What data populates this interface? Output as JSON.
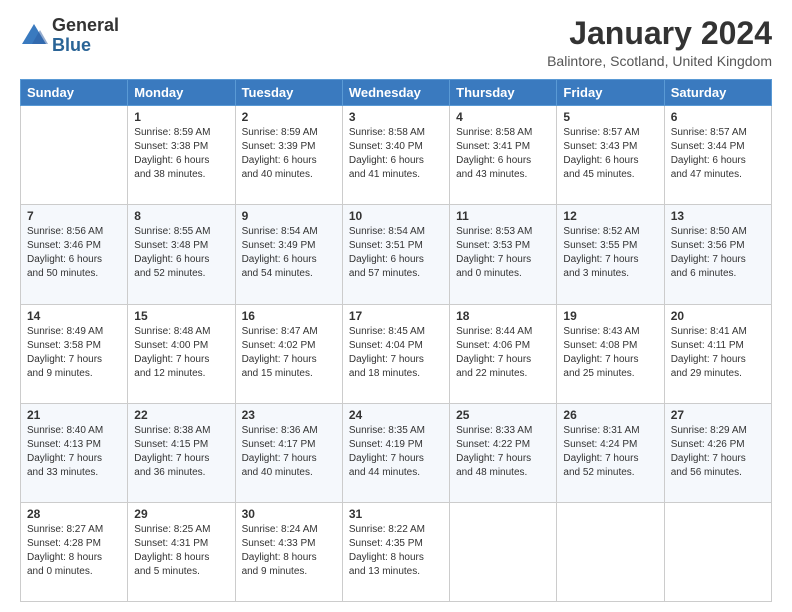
{
  "header": {
    "logo_general": "General",
    "logo_blue": "Blue",
    "title": "January 2024",
    "subtitle": "Balintore, Scotland, United Kingdom"
  },
  "days_of_week": [
    "Sunday",
    "Monday",
    "Tuesday",
    "Wednesday",
    "Thursday",
    "Friday",
    "Saturday"
  ],
  "weeks": [
    [
      {
        "day": "",
        "info": ""
      },
      {
        "day": "1",
        "info": "Sunrise: 8:59 AM\nSunset: 3:38 PM\nDaylight: 6 hours\nand 38 minutes."
      },
      {
        "day": "2",
        "info": "Sunrise: 8:59 AM\nSunset: 3:39 PM\nDaylight: 6 hours\nand 40 minutes."
      },
      {
        "day": "3",
        "info": "Sunrise: 8:58 AM\nSunset: 3:40 PM\nDaylight: 6 hours\nand 41 minutes."
      },
      {
        "day": "4",
        "info": "Sunrise: 8:58 AM\nSunset: 3:41 PM\nDaylight: 6 hours\nand 43 minutes."
      },
      {
        "day": "5",
        "info": "Sunrise: 8:57 AM\nSunset: 3:43 PM\nDaylight: 6 hours\nand 45 minutes."
      },
      {
        "day": "6",
        "info": "Sunrise: 8:57 AM\nSunset: 3:44 PM\nDaylight: 6 hours\nand 47 minutes."
      }
    ],
    [
      {
        "day": "7",
        "info": "Sunrise: 8:56 AM\nSunset: 3:46 PM\nDaylight: 6 hours\nand 50 minutes."
      },
      {
        "day": "8",
        "info": "Sunrise: 8:55 AM\nSunset: 3:48 PM\nDaylight: 6 hours\nand 52 minutes."
      },
      {
        "day": "9",
        "info": "Sunrise: 8:54 AM\nSunset: 3:49 PM\nDaylight: 6 hours\nand 54 minutes."
      },
      {
        "day": "10",
        "info": "Sunrise: 8:54 AM\nSunset: 3:51 PM\nDaylight: 6 hours\nand 57 minutes."
      },
      {
        "day": "11",
        "info": "Sunrise: 8:53 AM\nSunset: 3:53 PM\nDaylight: 7 hours\nand 0 minutes."
      },
      {
        "day": "12",
        "info": "Sunrise: 8:52 AM\nSunset: 3:55 PM\nDaylight: 7 hours\nand 3 minutes."
      },
      {
        "day": "13",
        "info": "Sunrise: 8:50 AM\nSunset: 3:56 PM\nDaylight: 7 hours\nand 6 minutes."
      }
    ],
    [
      {
        "day": "14",
        "info": "Sunrise: 8:49 AM\nSunset: 3:58 PM\nDaylight: 7 hours\nand 9 minutes."
      },
      {
        "day": "15",
        "info": "Sunrise: 8:48 AM\nSunset: 4:00 PM\nDaylight: 7 hours\nand 12 minutes."
      },
      {
        "day": "16",
        "info": "Sunrise: 8:47 AM\nSunset: 4:02 PM\nDaylight: 7 hours\nand 15 minutes."
      },
      {
        "day": "17",
        "info": "Sunrise: 8:45 AM\nSunset: 4:04 PM\nDaylight: 7 hours\nand 18 minutes."
      },
      {
        "day": "18",
        "info": "Sunrise: 8:44 AM\nSunset: 4:06 PM\nDaylight: 7 hours\nand 22 minutes."
      },
      {
        "day": "19",
        "info": "Sunrise: 8:43 AM\nSunset: 4:08 PM\nDaylight: 7 hours\nand 25 minutes."
      },
      {
        "day": "20",
        "info": "Sunrise: 8:41 AM\nSunset: 4:11 PM\nDaylight: 7 hours\nand 29 minutes."
      }
    ],
    [
      {
        "day": "21",
        "info": "Sunrise: 8:40 AM\nSunset: 4:13 PM\nDaylight: 7 hours\nand 33 minutes."
      },
      {
        "day": "22",
        "info": "Sunrise: 8:38 AM\nSunset: 4:15 PM\nDaylight: 7 hours\nand 36 minutes."
      },
      {
        "day": "23",
        "info": "Sunrise: 8:36 AM\nSunset: 4:17 PM\nDaylight: 7 hours\nand 40 minutes."
      },
      {
        "day": "24",
        "info": "Sunrise: 8:35 AM\nSunset: 4:19 PM\nDaylight: 7 hours\nand 44 minutes."
      },
      {
        "day": "25",
        "info": "Sunrise: 8:33 AM\nSunset: 4:22 PM\nDaylight: 7 hours\nand 48 minutes."
      },
      {
        "day": "26",
        "info": "Sunrise: 8:31 AM\nSunset: 4:24 PM\nDaylight: 7 hours\nand 52 minutes."
      },
      {
        "day": "27",
        "info": "Sunrise: 8:29 AM\nSunset: 4:26 PM\nDaylight: 7 hours\nand 56 minutes."
      }
    ],
    [
      {
        "day": "28",
        "info": "Sunrise: 8:27 AM\nSunset: 4:28 PM\nDaylight: 8 hours\nand 0 minutes."
      },
      {
        "day": "29",
        "info": "Sunrise: 8:25 AM\nSunset: 4:31 PM\nDaylight: 8 hours\nand 5 minutes."
      },
      {
        "day": "30",
        "info": "Sunrise: 8:24 AM\nSunset: 4:33 PM\nDaylight: 8 hours\nand 9 minutes."
      },
      {
        "day": "31",
        "info": "Sunrise: 8:22 AM\nSunset: 4:35 PM\nDaylight: 8 hours\nand 13 minutes."
      },
      {
        "day": "",
        "info": ""
      },
      {
        "day": "",
        "info": ""
      },
      {
        "day": "",
        "info": ""
      }
    ]
  ]
}
